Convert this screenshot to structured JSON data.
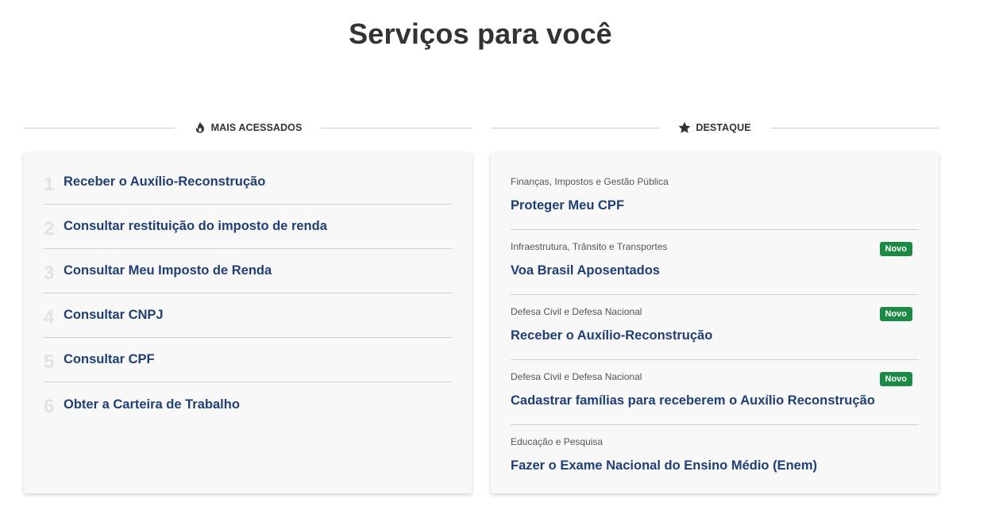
{
  "page": {
    "title": "Serviços para você"
  },
  "most_accessed": {
    "header": "MAIS ACESSADOS",
    "icon": "fire-icon",
    "items": [
      {
        "rank": "1",
        "label": "Receber o Auxílio-Reconstrução"
      },
      {
        "rank": "2",
        "label": "Consultar restituição do imposto de renda"
      },
      {
        "rank": "3",
        "label": "Consultar Meu Imposto de Renda"
      },
      {
        "rank": "4",
        "label": "Consultar CNPJ"
      },
      {
        "rank": "5",
        "label": "Consultar CPF"
      },
      {
        "rank": "6",
        "label": "Obter a Carteira de Trabalho"
      }
    ]
  },
  "featured": {
    "header": "DESTAQUE",
    "icon": "star-icon",
    "items": [
      {
        "category": "Finanças, Impostos e Gestão Pública",
        "title": "Proteger Meu CPF",
        "badge": ""
      },
      {
        "category": "Infraestrutura, Trânsito e Transportes",
        "title": "Voa Brasil Aposentados",
        "badge": "Novo"
      },
      {
        "category": "Defesa Civil e Defesa Nacional",
        "title": "Receber o Auxílio-Reconstrução",
        "badge": "Novo"
      },
      {
        "category": "Defesa Civil e Defesa Nacional",
        "title": "Cadastrar famílias para receberem o Auxílio Reconstrução",
        "badge": "Novo"
      },
      {
        "category": "Educação e Pesquisa",
        "title": "Fazer o Exame Nacional do Ensino Médio (Enem)",
        "badge": ""
      }
    ]
  },
  "colors": {
    "link": "#1f3f75",
    "badge_bg": "#1b8a45",
    "card_bg": "#f8f8f8"
  }
}
